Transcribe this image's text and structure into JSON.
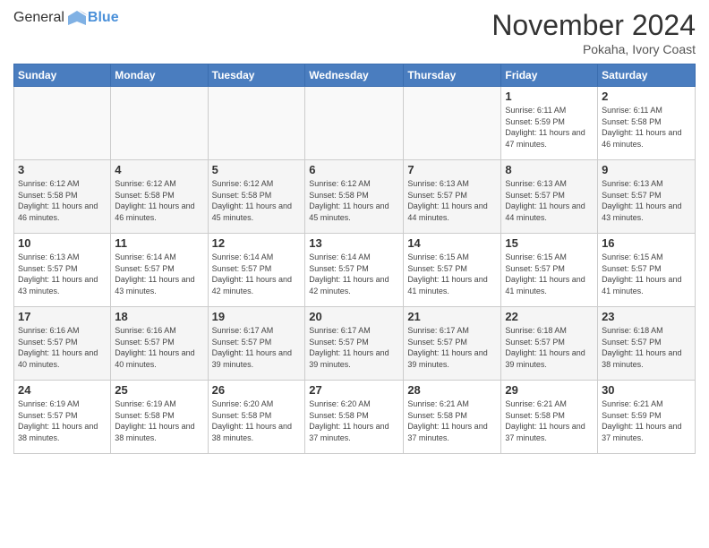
{
  "header": {
    "logo_general": "General",
    "logo_blue": "Blue",
    "title": "November 2024",
    "subtitle": "Pokaha, Ivory Coast"
  },
  "days_of_week": [
    "Sunday",
    "Monday",
    "Tuesday",
    "Wednesday",
    "Thursday",
    "Friday",
    "Saturday"
  ],
  "weeks": [
    [
      {
        "day": "",
        "info": ""
      },
      {
        "day": "",
        "info": ""
      },
      {
        "day": "",
        "info": ""
      },
      {
        "day": "",
        "info": ""
      },
      {
        "day": "",
        "info": ""
      },
      {
        "day": "1",
        "info": "Sunrise: 6:11 AM\nSunset: 5:59 PM\nDaylight: 11 hours and 47 minutes."
      },
      {
        "day": "2",
        "info": "Sunrise: 6:11 AM\nSunset: 5:58 PM\nDaylight: 11 hours and 46 minutes."
      }
    ],
    [
      {
        "day": "3",
        "info": "Sunrise: 6:12 AM\nSunset: 5:58 PM\nDaylight: 11 hours and 46 minutes."
      },
      {
        "day": "4",
        "info": "Sunrise: 6:12 AM\nSunset: 5:58 PM\nDaylight: 11 hours and 46 minutes."
      },
      {
        "day": "5",
        "info": "Sunrise: 6:12 AM\nSunset: 5:58 PM\nDaylight: 11 hours and 45 minutes."
      },
      {
        "day": "6",
        "info": "Sunrise: 6:12 AM\nSunset: 5:58 PM\nDaylight: 11 hours and 45 minutes."
      },
      {
        "day": "7",
        "info": "Sunrise: 6:13 AM\nSunset: 5:57 PM\nDaylight: 11 hours and 44 minutes."
      },
      {
        "day": "8",
        "info": "Sunrise: 6:13 AM\nSunset: 5:57 PM\nDaylight: 11 hours and 44 minutes."
      },
      {
        "day": "9",
        "info": "Sunrise: 6:13 AM\nSunset: 5:57 PM\nDaylight: 11 hours and 43 minutes."
      }
    ],
    [
      {
        "day": "10",
        "info": "Sunrise: 6:13 AM\nSunset: 5:57 PM\nDaylight: 11 hours and 43 minutes."
      },
      {
        "day": "11",
        "info": "Sunrise: 6:14 AM\nSunset: 5:57 PM\nDaylight: 11 hours and 43 minutes."
      },
      {
        "day": "12",
        "info": "Sunrise: 6:14 AM\nSunset: 5:57 PM\nDaylight: 11 hours and 42 minutes."
      },
      {
        "day": "13",
        "info": "Sunrise: 6:14 AM\nSunset: 5:57 PM\nDaylight: 11 hours and 42 minutes."
      },
      {
        "day": "14",
        "info": "Sunrise: 6:15 AM\nSunset: 5:57 PM\nDaylight: 11 hours and 41 minutes."
      },
      {
        "day": "15",
        "info": "Sunrise: 6:15 AM\nSunset: 5:57 PM\nDaylight: 11 hours and 41 minutes."
      },
      {
        "day": "16",
        "info": "Sunrise: 6:15 AM\nSunset: 5:57 PM\nDaylight: 11 hours and 41 minutes."
      }
    ],
    [
      {
        "day": "17",
        "info": "Sunrise: 6:16 AM\nSunset: 5:57 PM\nDaylight: 11 hours and 40 minutes."
      },
      {
        "day": "18",
        "info": "Sunrise: 6:16 AM\nSunset: 5:57 PM\nDaylight: 11 hours and 40 minutes."
      },
      {
        "day": "19",
        "info": "Sunrise: 6:17 AM\nSunset: 5:57 PM\nDaylight: 11 hours and 39 minutes."
      },
      {
        "day": "20",
        "info": "Sunrise: 6:17 AM\nSunset: 5:57 PM\nDaylight: 11 hours and 39 minutes."
      },
      {
        "day": "21",
        "info": "Sunrise: 6:17 AM\nSunset: 5:57 PM\nDaylight: 11 hours and 39 minutes."
      },
      {
        "day": "22",
        "info": "Sunrise: 6:18 AM\nSunset: 5:57 PM\nDaylight: 11 hours and 39 minutes."
      },
      {
        "day": "23",
        "info": "Sunrise: 6:18 AM\nSunset: 5:57 PM\nDaylight: 11 hours and 38 minutes."
      }
    ],
    [
      {
        "day": "24",
        "info": "Sunrise: 6:19 AM\nSunset: 5:57 PM\nDaylight: 11 hours and 38 minutes."
      },
      {
        "day": "25",
        "info": "Sunrise: 6:19 AM\nSunset: 5:58 PM\nDaylight: 11 hours and 38 minutes."
      },
      {
        "day": "26",
        "info": "Sunrise: 6:20 AM\nSunset: 5:58 PM\nDaylight: 11 hours and 38 minutes."
      },
      {
        "day": "27",
        "info": "Sunrise: 6:20 AM\nSunset: 5:58 PM\nDaylight: 11 hours and 37 minutes."
      },
      {
        "day": "28",
        "info": "Sunrise: 6:21 AM\nSunset: 5:58 PM\nDaylight: 11 hours and 37 minutes."
      },
      {
        "day": "29",
        "info": "Sunrise: 6:21 AM\nSunset: 5:58 PM\nDaylight: 11 hours and 37 minutes."
      },
      {
        "day": "30",
        "info": "Sunrise: 6:21 AM\nSunset: 5:59 PM\nDaylight: 11 hours and 37 minutes."
      }
    ]
  ]
}
